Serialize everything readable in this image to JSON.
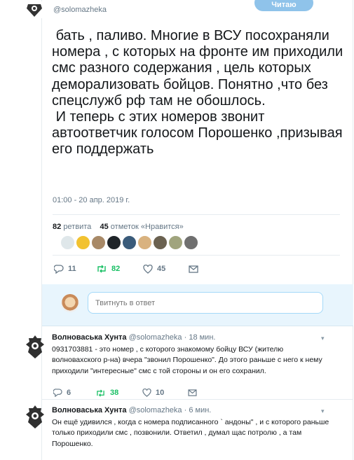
{
  "top": {
    "handle": "@solomazheka",
    "follow_label": "Читаю"
  },
  "tweet": {
    "text": " бать , паливо. Многие в ВСУ посохраняли номера , с которых на фронте им приходили смс разного содержания , цель которых деморализовать бойцов. Понятно ,что без спецслужб рф там не обошлось.\n И теперь с этих номеров звонит автоответчик голосом Порошенко ,призывая его поддержать",
    "timestamp": "01:00 - 20 апр. 2019 г.",
    "retweets_count": "82",
    "retweets_label": "ретвита",
    "likes_count": "45",
    "likes_label": "отметок «Нравится»",
    "actions": {
      "replies": "11",
      "retweets": "82",
      "likes": "45"
    }
  },
  "likers": [
    "#dfe7ea",
    "#f2c230",
    "#a88967",
    "#1f2428",
    "#3a5b7a",
    "#d9b27f",
    "#6a6150",
    "#a0a47d",
    "#6f6f6f"
  ],
  "reply_box": {
    "placeholder": "Твитнуть в ответ"
  },
  "replies": [
    {
      "name": "Волноваська Хунта",
      "handle": "@solomazheka",
      "time": "· 18 мин.",
      "text": "0931703881 - это номер , с которого знакомому бойцу ВСУ (жителю волноваxского р-на) вчера \"звонил Порошенко\". До этого раньше с него к нему приходили \"интересные\" смс с той стороны и он его сохранил.",
      "replies": "6",
      "retweets": "38",
      "likes": "10"
    },
    {
      "name": "Волноваська Хунта",
      "handle": "@solomazheka",
      "time": "· 6 мин.",
      "text": "Он ещё удивился , когда с номера подписанного ` андоны\" , и с которого раньше только приходили смс , позвонили. Ответил , думал щас потролю , а там Порошенко.",
      "replies": "",
      "retweets": "",
      "likes": ""
    }
  ]
}
